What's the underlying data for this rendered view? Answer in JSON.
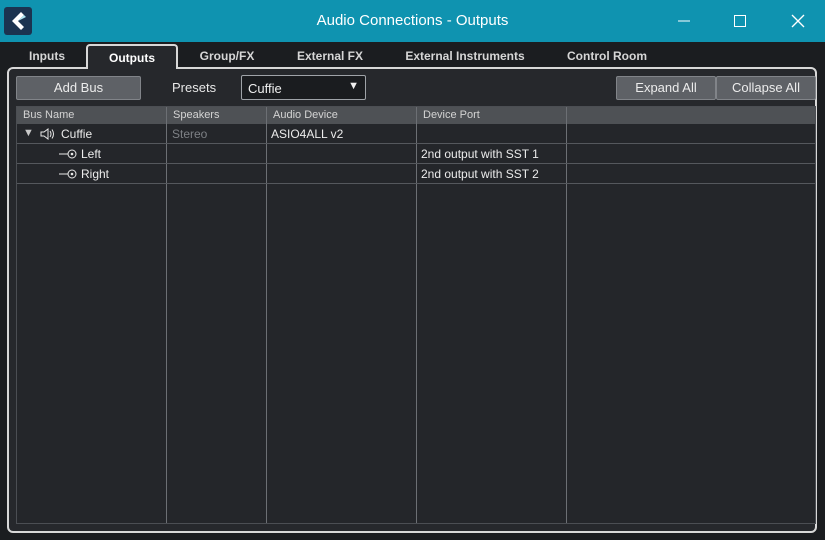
{
  "window": {
    "title": "Audio Connections - Outputs",
    "accent_color": "#0f93b0",
    "controls": [
      "minimize-icon",
      "maximize-icon",
      "close-icon"
    ]
  },
  "tabs": [
    {
      "label": "Inputs",
      "active": false
    },
    {
      "label": "Outputs",
      "active": true
    },
    {
      "label": "Group/FX",
      "active": false
    },
    {
      "label": "External FX",
      "active": false
    },
    {
      "label": "External Instruments",
      "active": false
    },
    {
      "label": "Control Room",
      "active": false
    }
  ],
  "toolbar": {
    "add_bus_label": "Add Bus",
    "presets_label": "Presets",
    "preset_value": "Cuffie",
    "expand_all_label": "Expand All",
    "collapse_all_label": "Collapse All"
  },
  "table": {
    "columns": [
      "Bus Name",
      "Speakers",
      "Audio Device",
      "Device Port"
    ],
    "rows": [
      {
        "name": "Cuffie",
        "icon": "speaker-icon",
        "expanded": true,
        "speakers": "Stereo",
        "audio_device": "ASIO4ALL v2",
        "device_port": ""
      },
      {
        "name": "Left",
        "icon": "output-port-icon",
        "speakers": "",
        "audio_device": "",
        "device_port": "2nd output with SST 1"
      },
      {
        "name": "Right",
        "icon": "output-port-icon",
        "speakers": "",
        "audio_device": "",
        "device_port": "2nd output with SST 2"
      }
    ]
  }
}
